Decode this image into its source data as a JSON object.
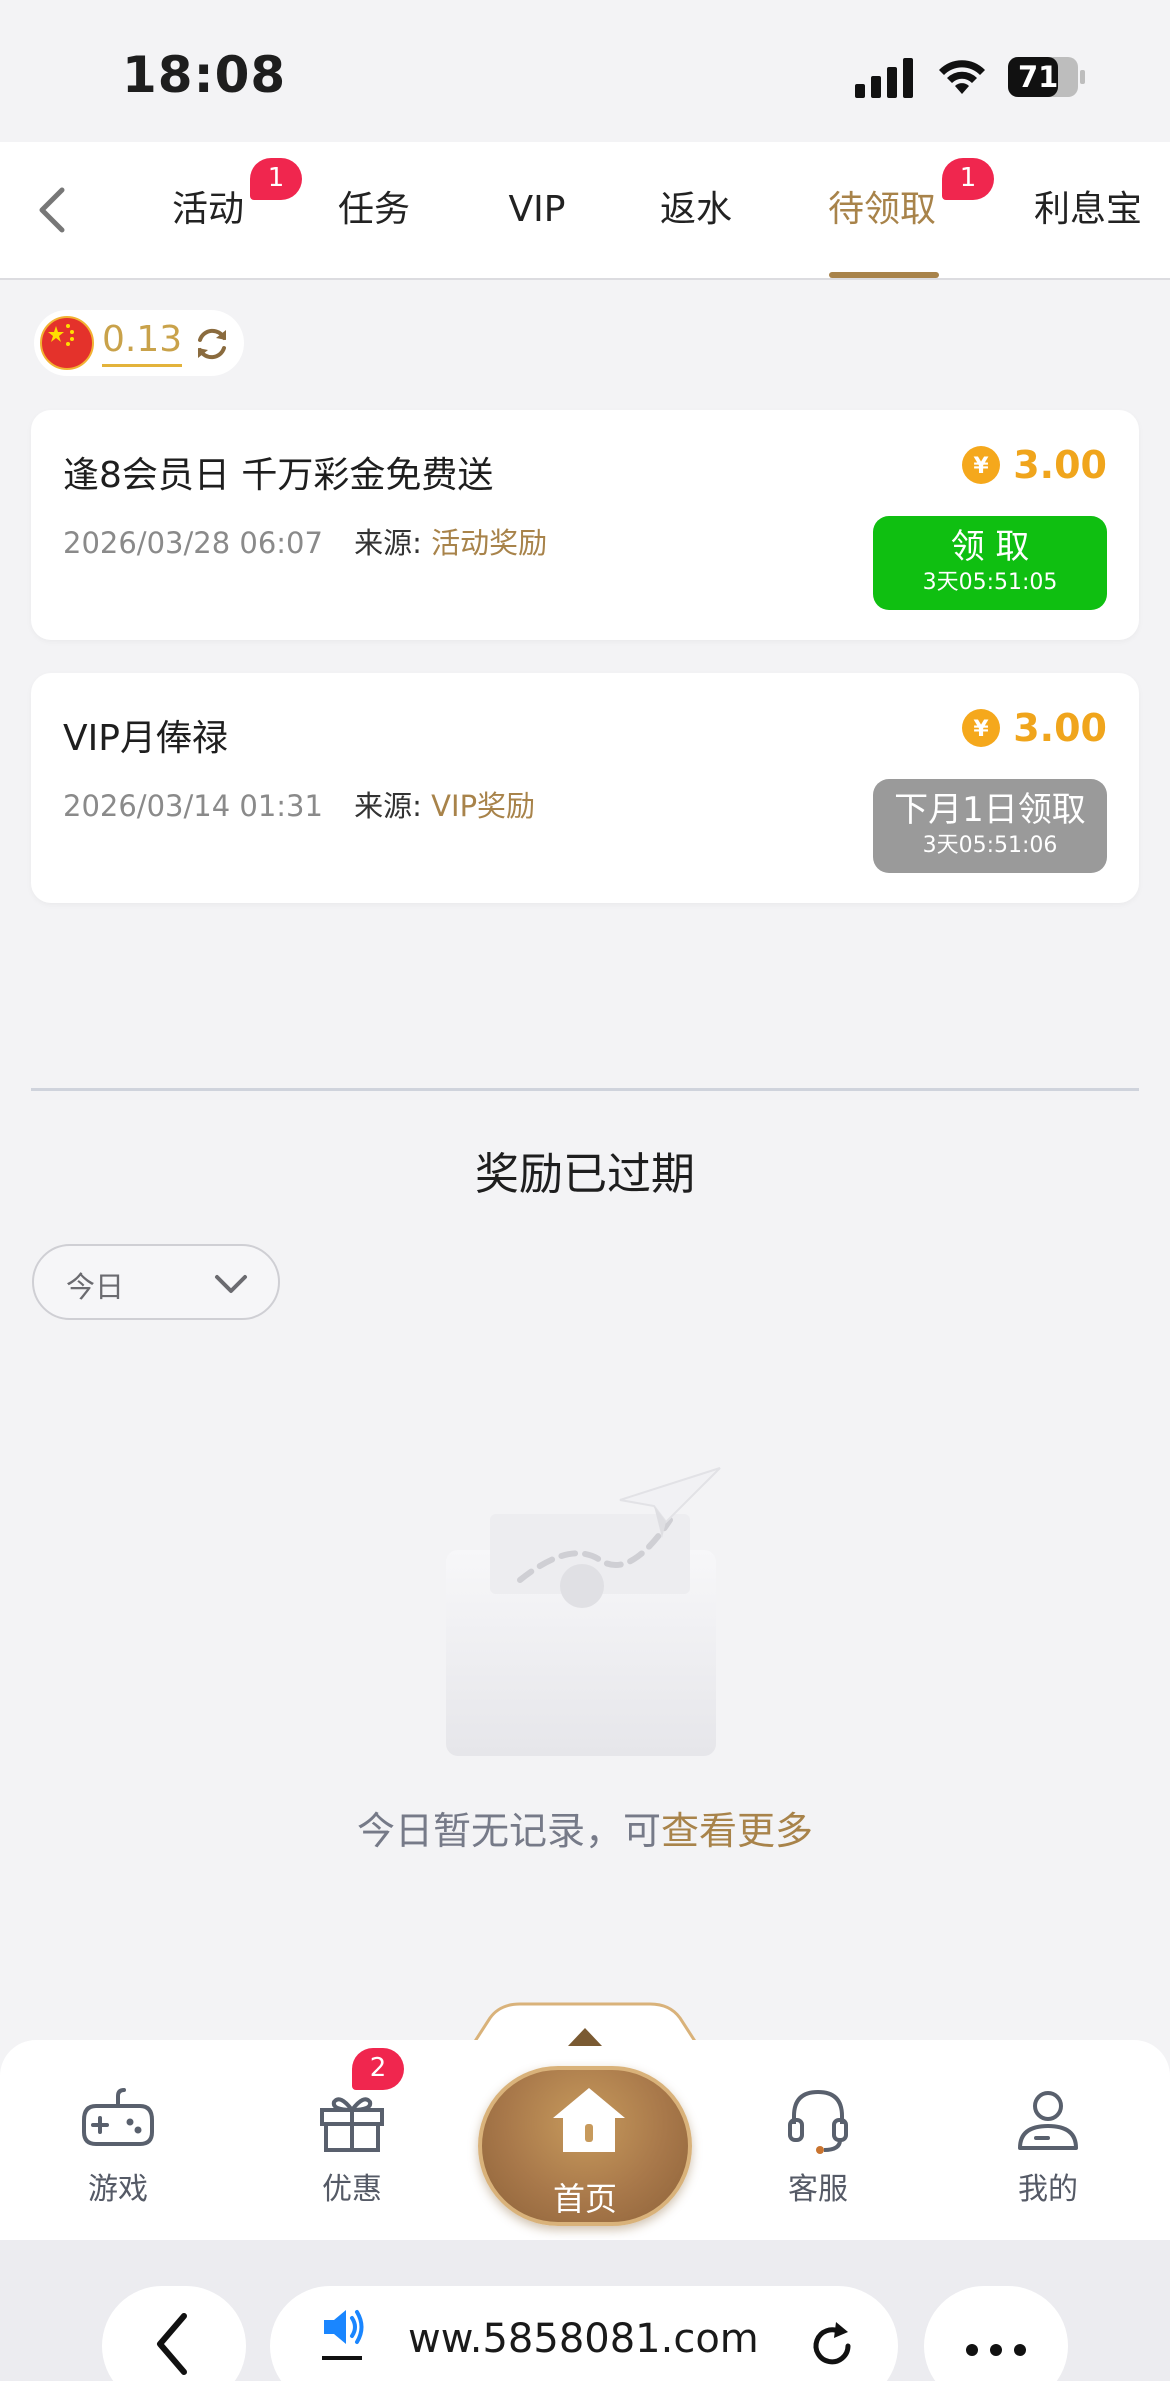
{
  "status_bar": {
    "time": "18:08",
    "battery": "71"
  },
  "tabs": [
    {
      "label": "活动",
      "badge": "1"
    },
    {
      "label": "任务"
    },
    {
      "label": "VIP"
    },
    {
      "label": "返水"
    },
    {
      "label": "待领取",
      "badge": "1",
      "active": true
    },
    {
      "label": "利息宝"
    }
  ],
  "balance": {
    "value": "0.13"
  },
  "rewards": [
    {
      "title": "逢8会员日 千万彩金免费送",
      "date": "2026/03/28 06:07",
      "source_label": "来源:",
      "source": "活动奖励",
      "amount": "3.00",
      "button_label": "领 取",
      "button_timer": "3天05:51:05",
      "button_color": "#0fbf11"
    },
    {
      "title": "VIP月俸禄",
      "date": "2026/03/14 01:31",
      "source_label": "来源:",
      "source": "VIP奖励",
      "amount": "3.00",
      "button_label": "下月1日领取",
      "button_timer": "3天05:51:06",
      "button_color": "#9a9a9a"
    }
  ],
  "expired": {
    "title": "奖励已过期",
    "filter_value": "今日",
    "empty_text": "今日暂无记录，可",
    "empty_link": "查看更多"
  },
  "bottom_nav": {
    "games": "游戏",
    "promos": "优惠",
    "promos_badge": "2",
    "home": "首页",
    "support": "客服",
    "mine": "我的"
  },
  "browser": {
    "url": "ww.5858081.com"
  },
  "colors": {
    "accent": "#a8834a",
    "gold": "#f0a51c",
    "badge": "#f0264e",
    "claim_green": "#0fbf11"
  },
  "icons": [
    "signal-icon",
    "wifi-icon",
    "battery-icon",
    "back-chevron-icon",
    "china-flag-icon",
    "refresh-icon",
    "coin-icon",
    "chevron-down-icon",
    "empty-box-icon",
    "gamepad-icon",
    "gift-icon",
    "home-icon",
    "headset-icon",
    "user-icon",
    "speaker-icon",
    "reload-icon",
    "more-icon"
  ]
}
